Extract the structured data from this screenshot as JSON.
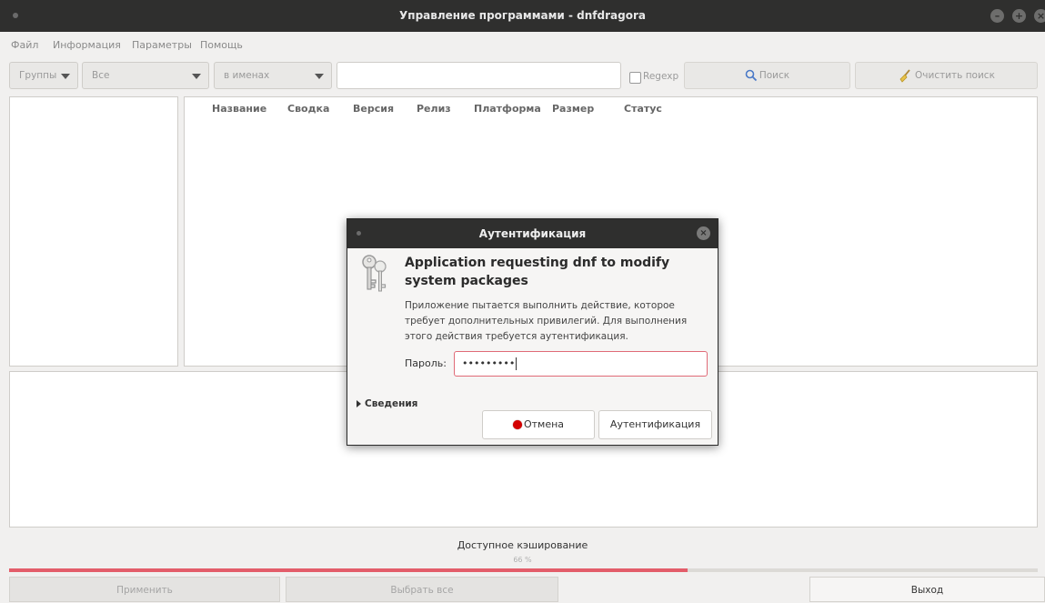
{
  "window": {
    "title": "Управление программами - dnfdragora"
  },
  "menu": [
    "Файл",
    "Информация",
    "Параметры",
    "Помощь"
  ],
  "toolbar": {
    "groups_label": "Группы",
    "filter_value": "Все",
    "search_in_value": "в именах",
    "search_value": "",
    "regexp_label": "Regexp",
    "search_button": "Поиск",
    "clear_button": "Очистить поиск"
  },
  "columns": [
    "Название",
    "Сводка",
    "Версия",
    "Релиз",
    "Платформа",
    "Размер",
    "Статус"
  ],
  "status": {
    "text": "Доступное кэширование",
    "percent_label": "66 %",
    "progress": 0.66
  },
  "buttons": {
    "apply": "Применить",
    "select_all": "Выбрать все",
    "exit": "Выход"
  },
  "dialog": {
    "title": "Аутентификация",
    "heading": "Application requesting dnf to modify system packages",
    "description": "Приложение пытается выполнить действие, которое требует дополнительных привилегий. Для выполнения этого действия требуется аутентификация.",
    "password_label": "Пароль:",
    "password_value": "•••••••••",
    "details_label": "Сведения",
    "cancel": "Отмена",
    "authenticate": "Аутентификация"
  },
  "colors": {
    "accent": "#e35d6a",
    "titlebar": "#2f2f2e",
    "cancel_dot": "#d40000"
  },
  "icons": [
    "keys-icon",
    "search-icon",
    "broom-icon",
    "close-icon",
    "minimize-icon",
    "maximize-icon"
  ]
}
